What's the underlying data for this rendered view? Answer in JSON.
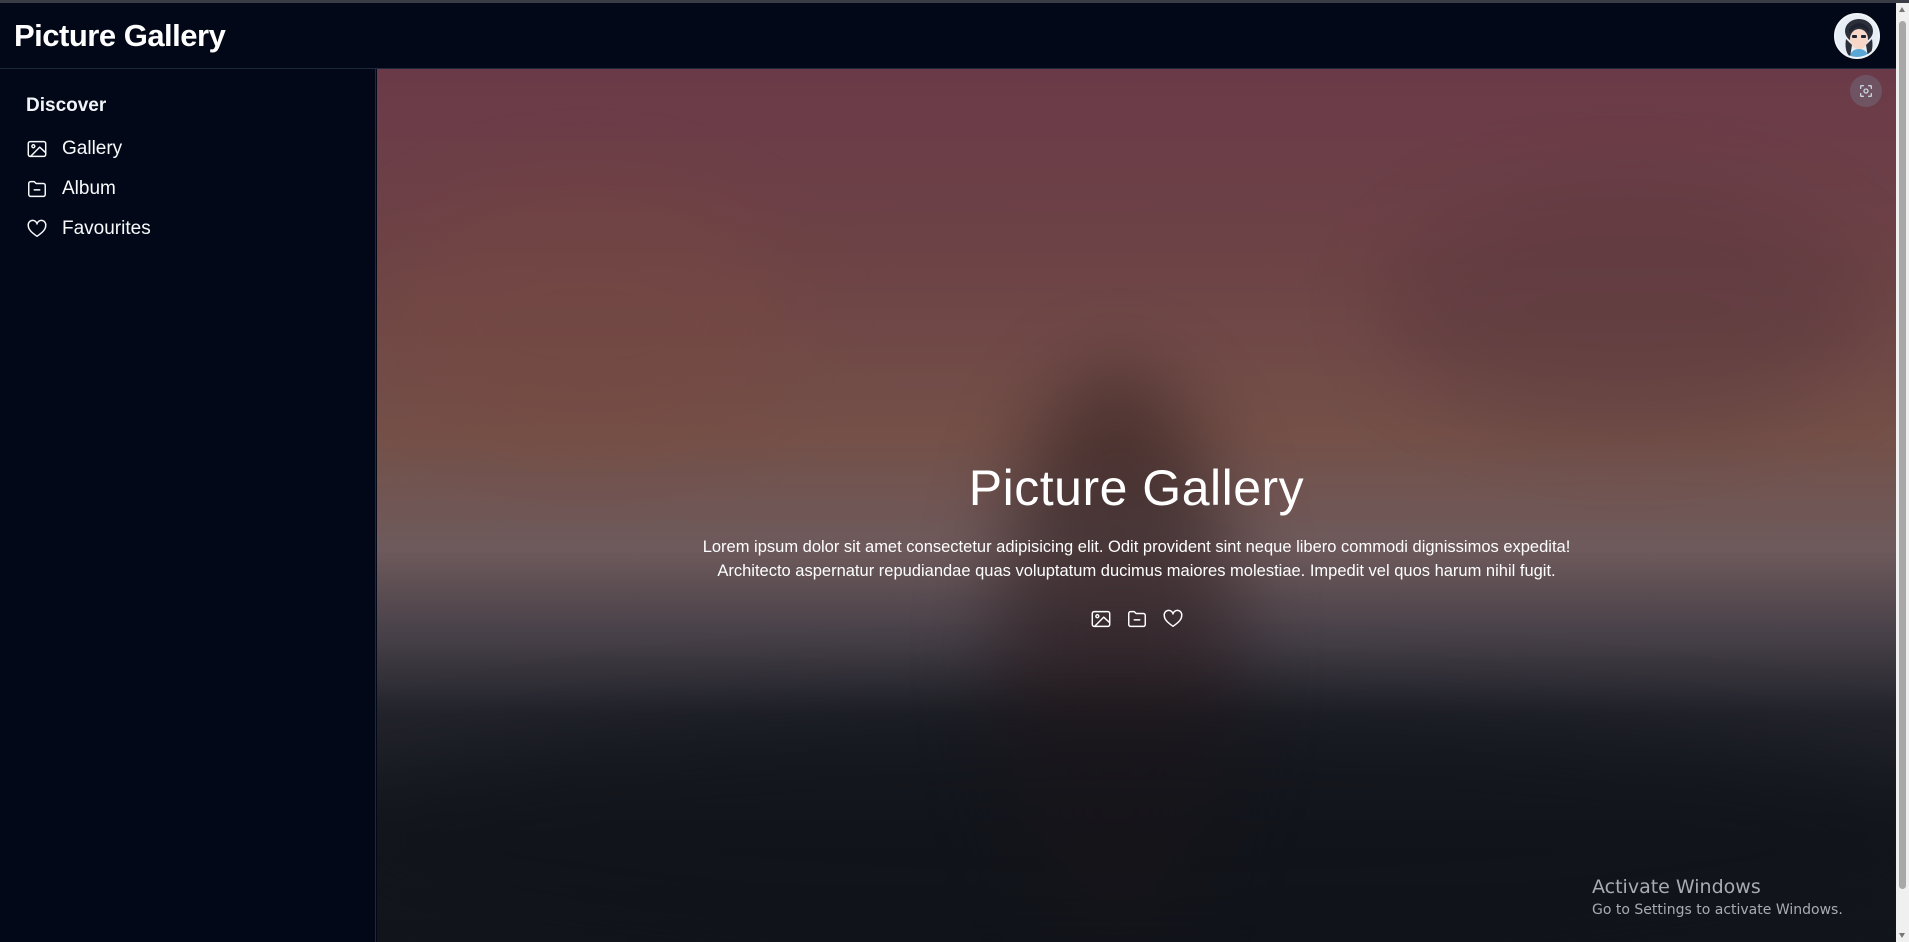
{
  "header": {
    "title": "Picture Gallery",
    "avatar_icon": "user-avatar"
  },
  "sidebar": {
    "heading": "Discover",
    "items": [
      {
        "label": "Gallery",
        "icon": "image-icon"
      },
      {
        "label": "Album",
        "icon": "folder-icon"
      },
      {
        "label": "Favourites",
        "icon": "heart-icon"
      }
    ]
  },
  "hero": {
    "title": "Picture Gallery",
    "description_line1": "Lorem ipsum dolor sit amet consectetur adipisicing elit. Odit provident sint neque libero commodi dignissimos expedita!",
    "description_line2": "Architecto aspernatur repudiandae quas voluptatum ducimus maiores molestiae. Impedit vel quos harum nihil fugit.",
    "icons": [
      "image-icon",
      "folder-icon",
      "heart-icon"
    ]
  },
  "watermark": {
    "title": "Activate Windows",
    "subtitle": "Go to Settings to activate Windows."
  },
  "colors": {
    "background": "#020817",
    "text": "#f8fafc",
    "border": "#1e293b"
  }
}
